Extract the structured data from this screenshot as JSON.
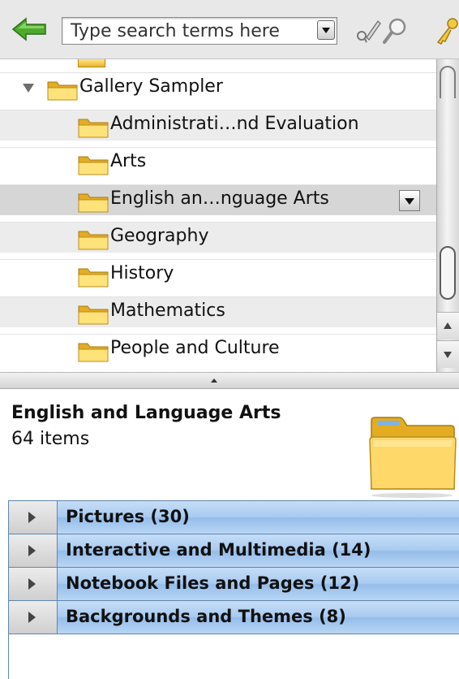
{
  "toolbar": {
    "search_placeholder": "Type search terms here",
    "icons": [
      "back-arrow-icon",
      "dropdown-arrow-icon",
      "pencil-search-icon",
      "magnifier-icon",
      "key-icon"
    ]
  },
  "tree": {
    "root": {
      "label": "Gallery Sampler",
      "expanded": true
    },
    "items": [
      {
        "label": "Administrati…nd Evaluation"
      },
      {
        "label": "Arts"
      },
      {
        "label": "English an…nguage Arts",
        "selected": true
      },
      {
        "label": "Geography"
      },
      {
        "label": "History"
      },
      {
        "label": "Mathematics"
      },
      {
        "label": "People and Culture"
      }
    ]
  },
  "info": {
    "title": "English and Language Arts",
    "count": "64 items"
  },
  "categories": [
    {
      "label": "Pictures (30)"
    },
    {
      "label": "Interactive and Multimedia (14)"
    },
    {
      "label": "Notebook Files and Pages (12)"
    },
    {
      "label": "Backgrounds and Themes (8)"
    }
  ],
  "colors": {
    "folder_light": "#ffe27a",
    "folder_dark": "#e3ac22",
    "category_blue": "#a9cbf0",
    "category_border": "#5f86ad",
    "back_arrow_green": "#4caa2c"
  }
}
